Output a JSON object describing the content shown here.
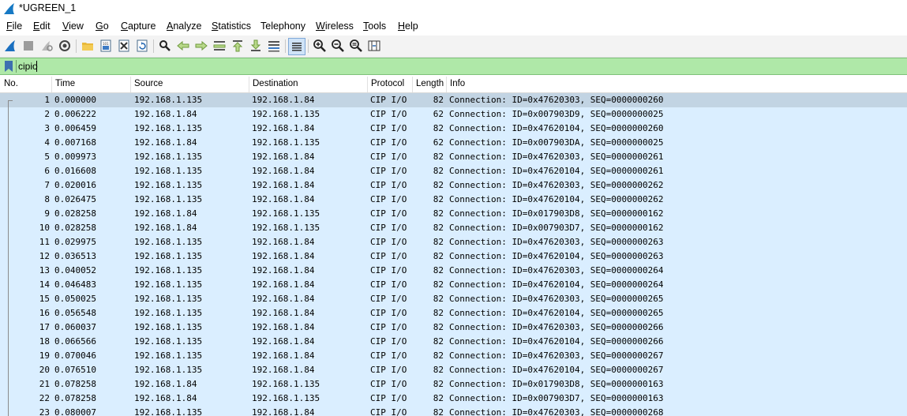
{
  "window": {
    "title": "*UGREEN_1"
  },
  "menu": [
    {
      "label": "File",
      "u": "F",
      "rest": "ile"
    },
    {
      "label": "Edit",
      "u": "E",
      "rest": "dit"
    },
    {
      "label": "View",
      "u": "V",
      "rest": "iew"
    },
    {
      "label": "Go",
      "u": "G",
      "rest": "o"
    },
    {
      "label": "Capture",
      "u": "C",
      "rest": "apture"
    },
    {
      "label": "Analyze",
      "u": "A",
      "rest": "nalyze"
    },
    {
      "label": "Statistics",
      "u": "S",
      "rest": "tatistics"
    },
    {
      "label": "Telephony",
      "u": "",
      "rest": "Telephony"
    },
    {
      "label": "Wireless",
      "u": "W",
      "rest": "ireless"
    },
    {
      "label": "Tools",
      "u": "T",
      "rest": "ools"
    },
    {
      "label": "Help",
      "u": "H",
      "rest": "elp"
    }
  ],
  "toolbar_icons": [
    "shark-fin-start-icon",
    "stop-capture-icon",
    "restart-capture-icon",
    "capture-options-icon",
    "open-file-icon",
    "save-file-icon",
    "close-file-icon",
    "reload-file-icon",
    "find-packet-icon",
    "go-back-icon",
    "go-forward-icon",
    "go-to-packet-icon",
    "go-first-icon",
    "go-last-icon",
    "autoscroll-icon",
    "colorize-icon",
    "zoom-in-icon",
    "zoom-out-icon",
    "zoom-normal-icon",
    "resize-columns-icon"
  ],
  "filter": {
    "value": "cipio"
  },
  "columns": {
    "no": "No.",
    "time": "Time",
    "source": "Source",
    "destination": "Destination",
    "protocol": "Protocol",
    "length": "Length",
    "info": "Info"
  },
  "packets": [
    {
      "no": "1",
      "time": "0.000000",
      "src": "192.168.1.135",
      "dst": "192.168.1.84",
      "proto": "CIP I/O",
      "len": "82",
      "info": "Connection: ID=0x47620303, SEQ=0000000260"
    },
    {
      "no": "2",
      "time": "0.006222",
      "src": "192.168.1.84",
      "dst": "192.168.1.135",
      "proto": "CIP I/O",
      "len": "62",
      "info": "Connection: ID=0x007903D9, SEQ=0000000025"
    },
    {
      "no": "3",
      "time": "0.006459",
      "src": "192.168.1.135",
      "dst": "192.168.1.84",
      "proto": "CIP I/O",
      "len": "82",
      "info": "Connection: ID=0x47620104, SEQ=0000000260"
    },
    {
      "no": "4",
      "time": "0.007168",
      "src": "192.168.1.84",
      "dst": "192.168.1.135",
      "proto": "CIP I/O",
      "len": "62",
      "info": "Connection: ID=0x007903DA, SEQ=0000000025"
    },
    {
      "no": "5",
      "time": "0.009973",
      "src": "192.168.1.135",
      "dst": "192.168.1.84",
      "proto": "CIP I/O",
      "len": "82",
      "info": "Connection: ID=0x47620303, SEQ=0000000261"
    },
    {
      "no": "6",
      "time": "0.016608",
      "src": "192.168.1.135",
      "dst": "192.168.1.84",
      "proto": "CIP I/O",
      "len": "82",
      "info": "Connection: ID=0x47620104, SEQ=0000000261"
    },
    {
      "no": "7",
      "time": "0.020016",
      "src": "192.168.1.135",
      "dst": "192.168.1.84",
      "proto": "CIP I/O",
      "len": "82",
      "info": "Connection: ID=0x47620303, SEQ=0000000262"
    },
    {
      "no": "8",
      "time": "0.026475",
      "src": "192.168.1.135",
      "dst": "192.168.1.84",
      "proto": "CIP I/O",
      "len": "82",
      "info": "Connection: ID=0x47620104, SEQ=0000000262"
    },
    {
      "no": "9",
      "time": "0.028258",
      "src": "192.168.1.84",
      "dst": "192.168.1.135",
      "proto": "CIP I/O",
      "len": "82",
      "info": "Connection: ID=0x017903D8, SEQ=0000000162"
    },
    {
      "no": "10",
      "time": "0.028258",
      "src": "192.168.1.84",
      "dst": "192.168.1.135",
      "proto": "CIP I/O",
      "len": "82",
      "info": "Connection: ID=0x007903D7, SEQ=0000000162"
    },
    {
      "no": "11",
      "time": "0.029975",
      "src": "192.168.1.135",
      "dst": "192.168.1.84",
      "proto": "CIP I/O",
      "len": "82",
      "info": "Connection: ID=0x47620303, SEQ=0000000263"
    },
    {
      "no": "12",
      "time": "0.036513",
      "src": "192.168.1.135",
      "dst": "192.168.1.84",
      "proto": "CIP I/O",
      "len": "82",
      "info": "Connection: ID=0x47620104, SEQ=0000000263"
    },
    {
      "no": "13",
      "time": "0.040052",
      "src": "192.168.1.135",
      "dst": "192.168.1.84",
      "proto": "CIP I/O",
      "len": "82",
      "info": "Connection: ID=0x47620303, SEQ=0000000264"
    },
    {
      "no": "14",
      "time": "0.046483",
      "src": "192.168.1.135",
      "dst": "192.168.1.84",
      "proto": "CIP I/O",
      "len": "82",
      "info": "Connection: ID=0x47620104, SEQ=0000000264"
    },
    {
      "no": "15",
      "time": "0.050025",
      "src": "192.168.1.135",
      "dst": "192.168.1.84",
      "proto": "CIP I/O",
      "len": "82",
      "info": "Connection: ID=0x47620303, SEQ=0000000265"
    },
    {
      "no": "16",
      "time": "0.056548",
      "src": "192.168.1.135",
      "dst": "192.168.1.84",
      "proto": "CIP I/O",
      "len": "82",
      "info": "Connection: ID=0x47620104, SEQ=0000000265"
    },
    {
      "no": "17",
      "time": "0.060037",
      "src": "192.168.1.135",
      "dst": "192.168.1.84",
      "proto": "CIP I/O",
      "len": "82",
      "info": "Connection: ID=0x47620303, SEQ=0000000266"
    },
    {
      "no": "18",
      "time": "0.066566",
      "src": "192.168.1.135",
      "dst": "192.168.1.84",
      "proto": "CIP I/O",
      "len": "82",
      "info": "Connection: ID=0x47620104, SEQ=0000000266"
    },
    {
      "no": "19",
      "time": "0.070046",
      "src": "192.168.1.135",
      "dst": "192.168.1.84",
      "proto": "CIP I/O",
      "len": "82",
      "info": "Connection: ID=0x47620303, SEQ=0000000267"
    },
    {
      "no": "20",
      "time": "0.076510",
      "src": "192.168.1.135",
      "dst": "192.168.1.84",
      "proto": "CIP I/O",
      "len": "82",
      "info": "Connection: ID=0x47620104, SEQ=0000000267"
    },
    {
      "no": "21",
      "time": "0.078258",
      "src": "192.168.1.84",
      "dst": "192.168.1.135",
      "proto": "CIP I/O",
      "len": "82",
      "info": "Connection: ID=0x017903D8, SEQ=0000000163"
    },
    {
      "no": "22",
      "time": "0.078258",
      "src": "192.168.1.84",
      "dst": "192.168.1.135",
      "proto": "CIP I/O",
      "len": "82",
      "info": "Connection: ID=0x007903D7, SEQ=0000000163"
    },
    {
      "no": "23",
      "time": "0.080007",
      "src": "192.168.1.135",
      "dst": "192.168.1.84",
      "proto": "CIP I/O",
      "len": "82",
      "info": "Connection: ID=0x47620303, SEQ=0000000268"
    }
  ],
  "colors": {
    "filter_valid": "#afe8a8",
    "row_bg": "#daeeff",
    "row_selected": "#c2d4e3"
  }
}
